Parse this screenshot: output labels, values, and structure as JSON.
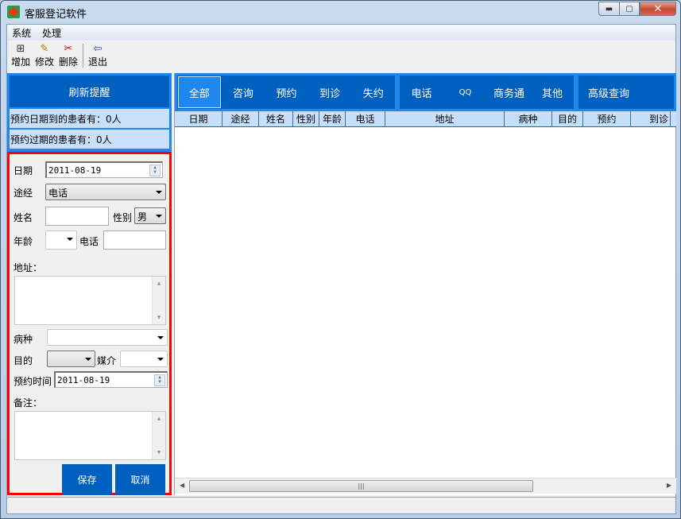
{
  "window": {
    "title": "客服登记软件",
    "icon": "red-cross-icon",
    "controls": {
      "minimize": "▬",
      "maximize": "▢",
      "close": "✕"
    }
  },
  "menubar": {
    "items": [
      {
        "label": "系统"
      },
      {
        "label": "处理"
      }
    ]
  },
  "toolbar": {
    "buttons": [
      {
        "label": "增加",
        "icon": "add-record-icon",
        "glyph": "⊞"
      },
      {
        "label": "修改",
        "icon": "edit-record-icon",
        "glyph": "✎"
      },
      {
        "label": "删除",
        "icon": "scissors-icon",
        "glyph": "✂"
      },
      {
        "label": "退出",
        "icon": "exit-door-icon",
        "glyph": "⇦"
      }
    ]
  },
  "left_panel": {
    "refresh_label": "刷新提醒",
    "reminders": [
      {
        "text": "预约日期到的患者有：0人"
      },
      {
        "text": "预约过期的患者有：0人"
      }
    ]
  },
  "form": {
    "date_label": "日期",
    "date_value": "2011-08-19",
    "channel_label": "途经",
    "channel_value": "电话",
    "name_label": "姓名",
    "name_value": "",
    "gender_label": "性别",
    "gender_value": "男",
    "age_label": "年龄",
    "age_value": "",
    "phone_label": "电话",
    "phone_value": "",
    "address_label": "地址：",
    "address_value": "",
    "disease_label": "病种",
    "disease_value": "",
    "purpose_label": "目的",
    "purpose_value": "",
    "media_label": "媒介",
    "media_value": "",
    "appt_time_label": "预约时间",
    "appt_time_value": "2011-08-19",
    "notes_label": "备注：",
    "notes_value": "",
    "save_label": "保存",
    "cancel_label": "取消"
  },
  "tabs": {
    "group1": [
      {
        "label": "全部",
        "active": true
      },
      {
        "label": "咨询"
      },
      {
        "label": "预约"
      },
      {
        "label": "到诊"
      },
      {
        "label": "失约"
      }
    ],
    "group2": [
      {
        "label": "电话"
      },
      {
        "label": "QQ"
      },
      {
        "label": "商务通"
      },
      {
        "label": "其他"
      }
    ],
    "group3": [
      {
        "label": "高级查询"
      }
    ]
  },
  "grid": {
    "columns": [
      {
        "label": "日期"
      },
      {
        "label": "途经"
      },
      {
        "label": "姓名"
      },
      {
        "label": "性别"
      },
      {
        "label": "年龄"
      },
      {
        "label": "电话"
      },
      {
        "label": "地址"
      },
      {
        "label": "病种"
      },
      {
        "label": "目的"
      },
      {
        "label": "预约"
      },
      {
        "label": "到诊"
      }
    ],
    "rows": []
  },
  "colors": {
    "accent_blue": "#1e88f0",
    "dark_blue": "#0060c0",
    "header_light_blue": "#c6e0fb",
    "form_border_red": "#ff0000"
  }
}
